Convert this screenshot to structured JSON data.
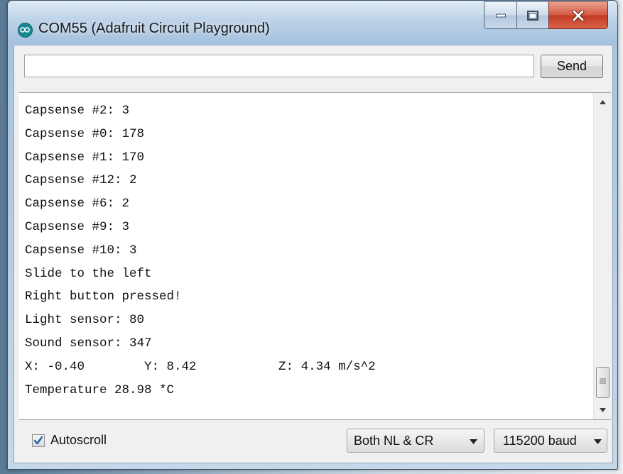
{
  "window": {
    "title": "COM55 (Adafruit Circuit Playground)",
    "icon": "arduino-infinity-icon",
    "controls": [
      "minimize-icon",
      "maximize-icon",
      "close-icon"
    ]
  },
  "input": {
    "value": "",
    "send_label": "Send"
  },
  "output": {
    "lines": [
      "Capsense #2: 3",
      "Capsense #0: 178",
      "Capsense #1: 170",
      "Capsense #12: 2",
      "Capsense #6: 2",
      "Capsense #9: 3",
      "Capsense #10: 3",
      "Slide to the left",
      "Right button pressed!",
      "Light sensor: 80",
      "Sound sensor: 347",
      "X: -0.40        Y: 8.42           Z: 4.34 m/s^2",
      "Temperature 28.98 *C"
    ]
  },
  "footer": {
    "autoscroll_label": "Autoscroll",
    "autoscroll_checked": true,
    "line_ending": "Both NL & CR",
    "baud": "115200 baud"
  },
  "colors": {
    "arduino_teal": "#168a93",
    "close_red": "#c23a22",
    "checkmark_blue": "#2a5db0"
  }
}
